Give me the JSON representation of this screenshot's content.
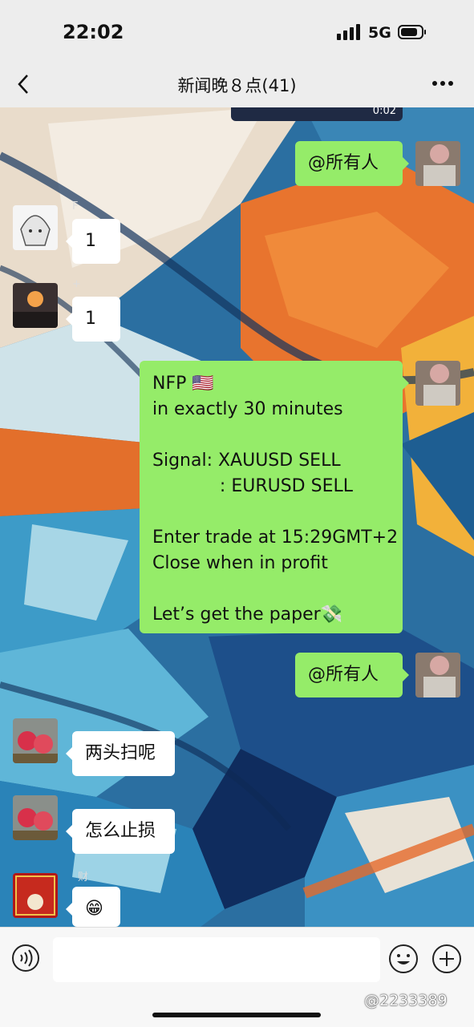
{
  "status_bar": {
    "time": "22:02",
    "network": "5G"
  },
  "nav": {
    "title": "新闻晚８点(41)"
  },
  "video": {
    "duration": "0:02"
  },
  "messages": [
    {
      "side": "right",
      "text": "@所有人"
    },
    {
      "side": "left",
      "sender": "F",
      "text": "1"
    },
    {
      "side": "left",
      "sender": "+ ",
      "text": "1"
    },
    {
      "side": "right",
      "lines": [
        "NFP 🇺🇸",
        "in exactly 30 minutes",
        "",
        "Signal: XAUUSD SELL",
        "            : EURUSD SELL",
        "",
        "Enter trade at 15:29GMT+2",
        "Close when in profit",
        "",
        "Let’s get the paper💸"
      ]
    },
    {
      "side": "right",
      "text": "@所有人"
    },
    {
      "side": "left",
      "text": "两头扫呢"
    },
    {
      "side": "left",
      "sender": "财",
      "text": "怎么止损"
    },
    {
      "side": "left",
      "text": "😁"
    }
  ],
  "input": {
    "placeholder": ""
  },
  "watermark": "@2233389",
  "colors": {
    "bubble_green": "#95ec69",
    "bubble_white": "#ffffff",
    "bar_bg": "#ededed"
  }
}
